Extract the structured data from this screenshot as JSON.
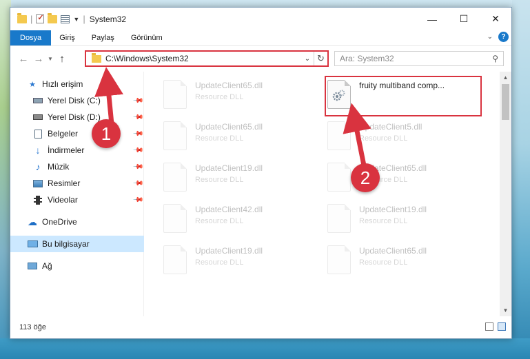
{
  "window": {
    "title": "System32",
    "controls": {
      "minimize": "—",
      "maximize": "☐",
      "close": "✕"
    }
  },
  "ribbon": {
    "tabs": [
      "Dosya",
      "Giriş",
      "Paylaş",
      "Görünüm"
    ],
    "help": "?"
  },
  "address": {
    "path": "C:\\Windows\\System32",
    "search_placeholder": "Ara: System32"
  },
  "nav": {
    "quick_access": "Hızlı erişim",
    "items": [
      {
        "label": "Yerel Disk (C:)",
        "icon": "drive-c-icon"
      },
      {
        "label": "Yerel Disk (D:)",
        "icon": "drive-d-icon"
      },
      {
        "label": "Belgeler",
        "icon": "documents-icon"
      },
      {
        "label": "İndirmeler",
        "icon": "downloads-icon"
      },
      {
        "label": "Müzik",
        "icon": "music-icon"
      },
      {
        "label": "Resimler",
        "icon": "pictures-icon"
      },
      {
        "label": "Videolar",
        "icon": "videos-icon"
      }
    ],
    "onedrive": "OneDrive",
    "this_pc": "Bu bilgisayar",
    "network": "Ağ"
  },
  "files": {
    "highlighted": {
      "name": "fruity multiband comp...",
      "type": ""
    },
    "left_column": [
      {
        "name": "UpdateClient65.dll",
        "type": "Resource DLL"
      },
      {
        "name": "UpdateClient65.dll",
        "type": "Resource DLL"
      },
      {
        "name": "UpdateClient19.dll",
        "type": "Resource DLL"
      },
      {
        "name": "UpdateClient42.dll",
        "type": "Resource DLL"
      },
      {
        "name": "UpdateClient19.dll",
        "type": "Resource DLL"
      }
    ],
    "right_column": [
      {
        "name": "UpdateClient5.dll",
        "type": "Resource DLL"
      },
      {
        "name": "UpdateClient65.dll",
        "type": "Resource DLL"
      },
      {
        "name": "UpdateClient19.dll",
        "type": "Resource DLL"
      },
      {
        "name": "UpdateClient65.dll",
        "type": "Resource DLL"
      }
    ]
  },
  "status": {
    "item_count": "113 öğe"
  },
  "annotations": {
    "step1": "1",
    "step2": "2",
    "color": "#d9333f"
  }
}
